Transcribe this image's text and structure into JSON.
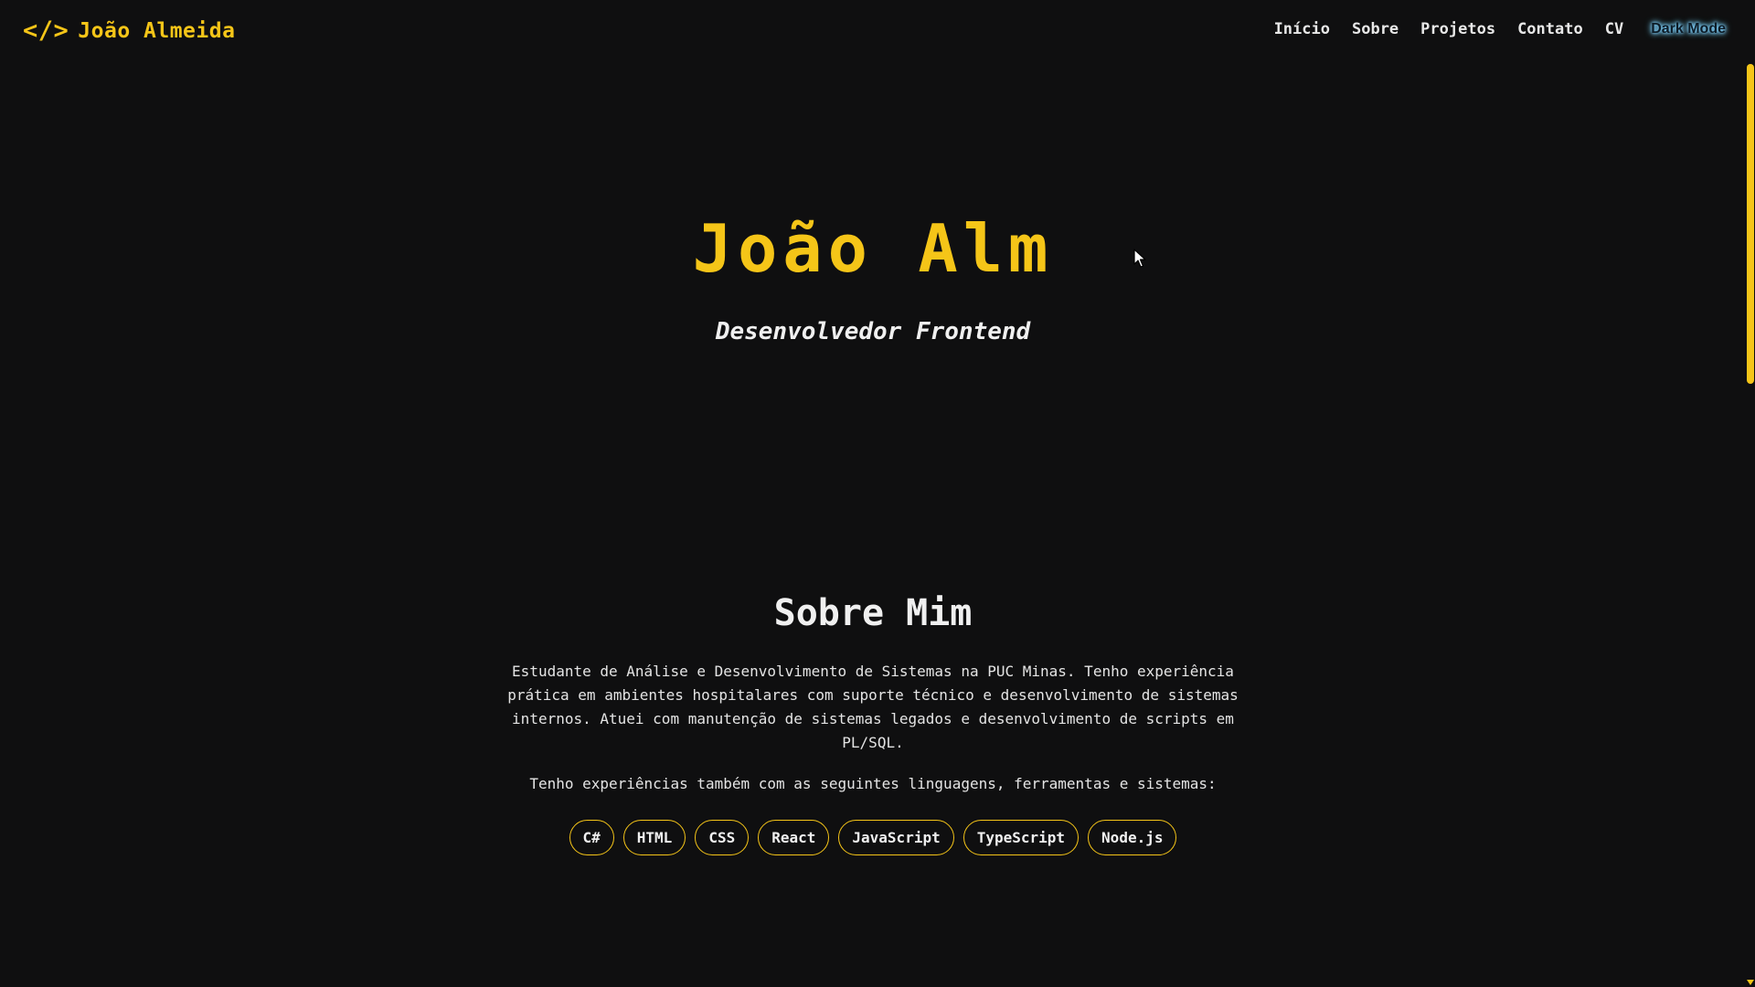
{
  "header": {
    "logo_icon": "</>",
    "logo_text": "João Almeida",
    "nav": [
      {
        "label": "Início"
      },
      {
        "label": "Sobre"
      },
      {
        "label": "Projetos"
      },
      {
        "label": "Contato"
      },
      {
        "label": "CV"
      }
    ],
    "theme_toggle_label": "Dark Mode"
  },
  "hero": {
    "title": "João Alm",
    "subtitle": "Desenvolvedor Frontend"
  },
  "about": {
    "title": "Sobre Mim",
    "paragraph": "Estudante de Análise e Desenvolvimento de Sistemas na PUC Minas. Tenho experiência prática em ambientes hospitalares com suporte técnico e desenvolvimento de sistemas internos. Atuei com manutenção de sistemas legados e desenvolvimento de scripts em PL/SQL.",
    "skills_intro": "Tenho experiências também com as seguintes linguagens, ferramentas e sistemas:",
    "skills": [
      "C#",
      "HTML",
      "CSS",
      "React",
      "JavaScript",
      "TypeScript",
      "Node.js"
    ]
  },
  "colors": {
    "accent": "#f5c518",
    "background": "#0f0f10",
    "text": "#f0f0f0",
    "toggle_glow": "#7fd3ff"
  },
  "icons": {
    "logo": "code-brackets-icon",
    "cursor": "mouse-pointer-icon",
    "scroll_down": "scroll-down-arrow-icon"
  }
}
